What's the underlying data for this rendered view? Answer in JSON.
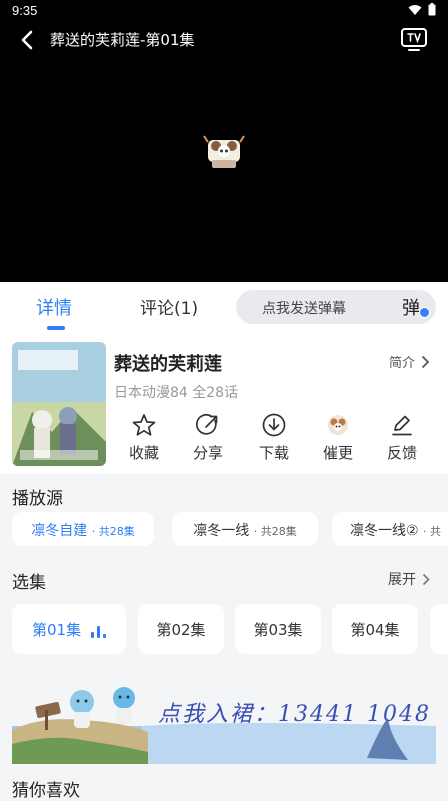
{
  "status_bar": {
    "time": "9:35"
  },
  "player": {
    "title": "葬送的芙莉莲-第01集"
  },
  "tabs": {
    "details": "详情",
    "comments": "评论(1)"
  },
  "danmaku": {
    "placeholder": "点我发送弹幕",
    "button": "弹"
  },
  "anime": {
    "title": "葬送的芙莉莲",
    "meta": "日本动漫84 全28话",
    "intro": "简介"
  },
  "actions": [
    {
      "label": "收藏",
      "icon": "star-icon"
    },
    {
      "label": "分享",
      "icon": "share-icon"
    },
    {
      "label": "下载",
      "icon": "download-icon"
    },
    {
      "label": "催更",
      "icon": "mascot-icon"
    },
    {
      "label": "反馈",
      "icon": "edit-icon"
    }
  ],
  "sources": {
    "title": "播放源",
    "items": [
      {
        "name": "凛冬自建",
        "count": "· 共28集",
        "active": true
      },
      {
        "name": "凛冬一线",
        "count": "· 共28集",
        "active": false
      },
      {
        "name": "凛冬一线②",
        "count": "· 共",
        "active": false
      }
    ]
  },
  "episodes": {
    "title": "选集",
    "expand": "展开",
    "items": [
      "第01集",
      "第02集",
      "第03集",
      "第04集"
    ],
    "active_index": 0
  },
  "banner": {
    "text": "点我入裙：13441 1048"
  },
  "recommend": {
    "title": "猜你喜欢"
  },
  "colors": {
    "accent": "#2f7df6",
    "background": "#f4f5f7",
    "player": "#000000"
  }
}
